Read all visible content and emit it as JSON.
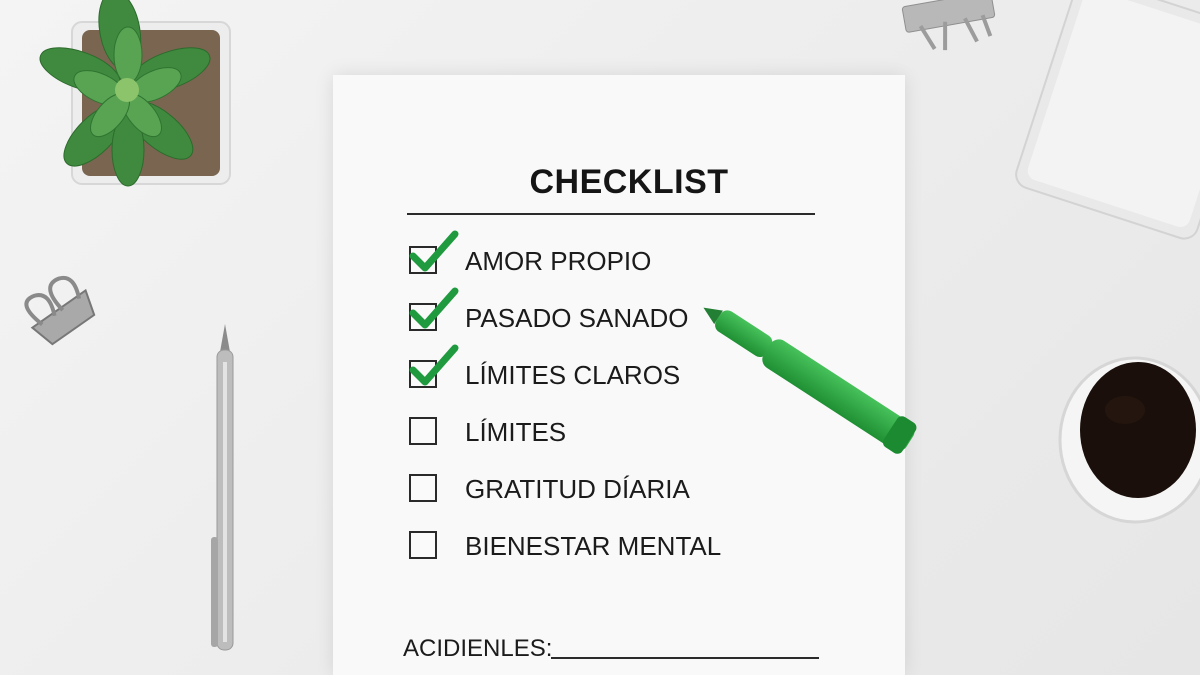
{
  "checklist": {
    "title": "CHECKLIST",
    "items": [
      {
        "label": "AMOR PROPIO",
        "checked": true
      },
      {
        "label": "PASADO SANADO",
        "checked": true
      },
      {
        "label": "LÍMITES CLAROS",
        "checked": true
      },
      {
        "label": "LÍMITES",
        "checked": false
      },
      {
        "label": "GRATITUD DÍARIA",
        "checked": false
      },
      {
        "label": "BIENESTAR MENTAL",
        "checked": false
      }
    ],
    "footer_label": "ACIDIENLES:"
  },
  "colors": {
    "check_green": "#1f9a3e",
    "marker_green": "#2fae45",
    "coffee": "#1a0f0a"
  },
  "icons": [
    "succulent-plant-icon",
    "binder-clip-icon",
    "pen-icon",
    "marker-icon",
    "coffee-cup-icon",
    "notebook-icon"
  ]
}
